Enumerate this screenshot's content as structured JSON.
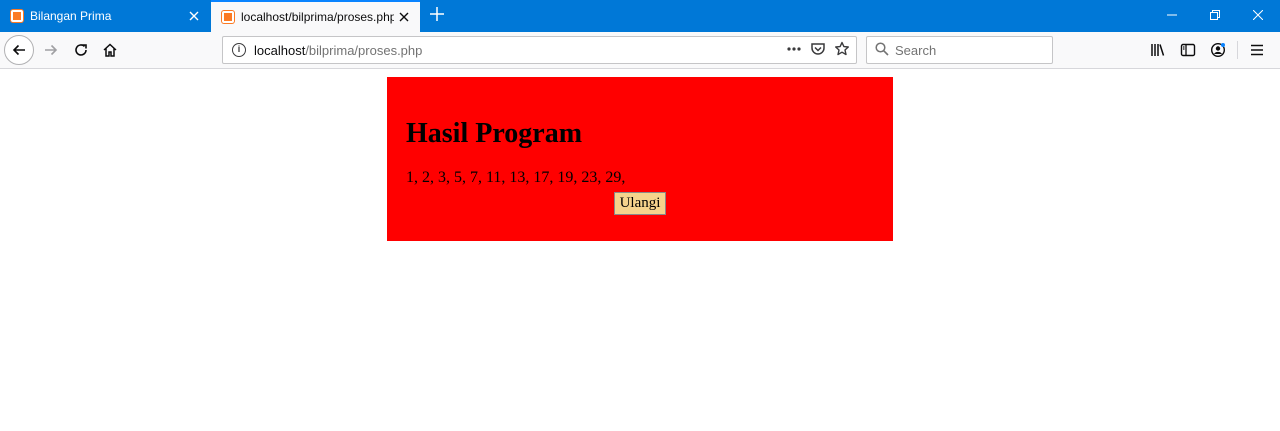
{
  "browser": {
    "tabs": [
      {
        "title": "Bilangan Prima",
        "active": false
      },
      {
        "title": "localhost/bilprima/proses.php",
        "active": true
      }
    ],
    "url": {
      "host": "localhost",
      "path": "/bilprima/proses.php"
    },
    "search": {
      "placeholder": "Search"
    },
    "colors": {
      "tabstrip": "#0078d7",
      "favicon": "#fb7a24"
    }
  },
  "page": {
    "heading": "Hasil Program",
    "primes_text": "1, 2, 3, 5, 7, 11, 13, 17, 19, 23, 29,",
    "button_label": "Ulangi",
    "colors": {
      "box_background": "#ff0000",
      "button_background": "#f6d38c"
    }
  }
}
